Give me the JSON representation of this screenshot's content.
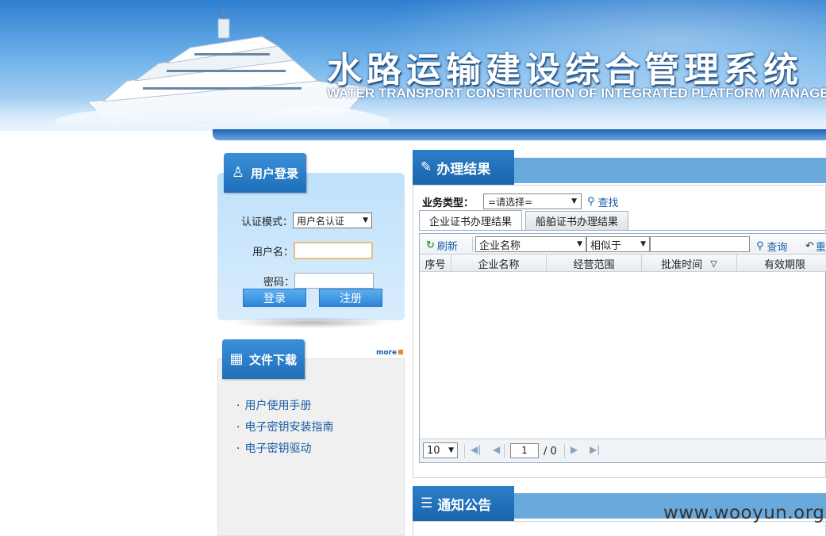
{
  "header": {
    "title": "水路运输建设综合管理系统",
    "subtitle": "WATER TRANSPORT CONSTRUCTION OF INTEGRATED PLATFORM MANAGEMENT S"
  },
  "login": {
    "heading": "用户登录",
    "auth_mode_label": "认证模式：",
    "auth_mode_value": "用户名认证",
    "username_label": "用户名：",
    "password_label": "密码：",
    "login_button": "登录",
    "register_button": "注册"
  },
  "downloads": {
    "heading": "文件下载",
    "more": "more",
    "items": [
      {
        "label": "用户使用手册"
      },
      {
        "label": "电子密钥安装指南"
      },
      {
        "label": "电子密钥驱动"
      }
    ]
  },
  "results": {
    "heading": "办理结果",
    "business_type_label": "业务类型：",
    "business_type_value": "=请选择=",
    "find_button": "查找",
    "tabs": [
      {
        "label": "企业证书办理结果",
        "active": true
      },
      {
        "label": "船舶证书办理结果",
        "active": false
      }
    ],
    "toolbar": {
      "refresh": "刷新",
      "field": "企业名称",
      "operator": "相似于",
      "keyword": "",
      "query": "查询",
      "reset": "重"
    },
    "columns": [
      {
        "label": "序号"
      },
      {
        "label": "企业名称"
      },
      {
        "label": "经营范围"
      },
      {
        "label": "批准时间"
      },
      {
        "label": "有效期限"
      }
    ],
    "pager": {
      "page_size": "10",
      "current_page": "1",
      "total": "/ 0"
    }
  },
  "notices": {
    "heading": "通知公告"
  },
  "watermark": "www.wooyun.org",
  "colors": {
    "header_blue": "#2f7fd0",
    "panel_blue": "#1a64ac",
    "link_blue": "#1a5ea8",
    "login_bg": "#bfe1fb"
  }
}
